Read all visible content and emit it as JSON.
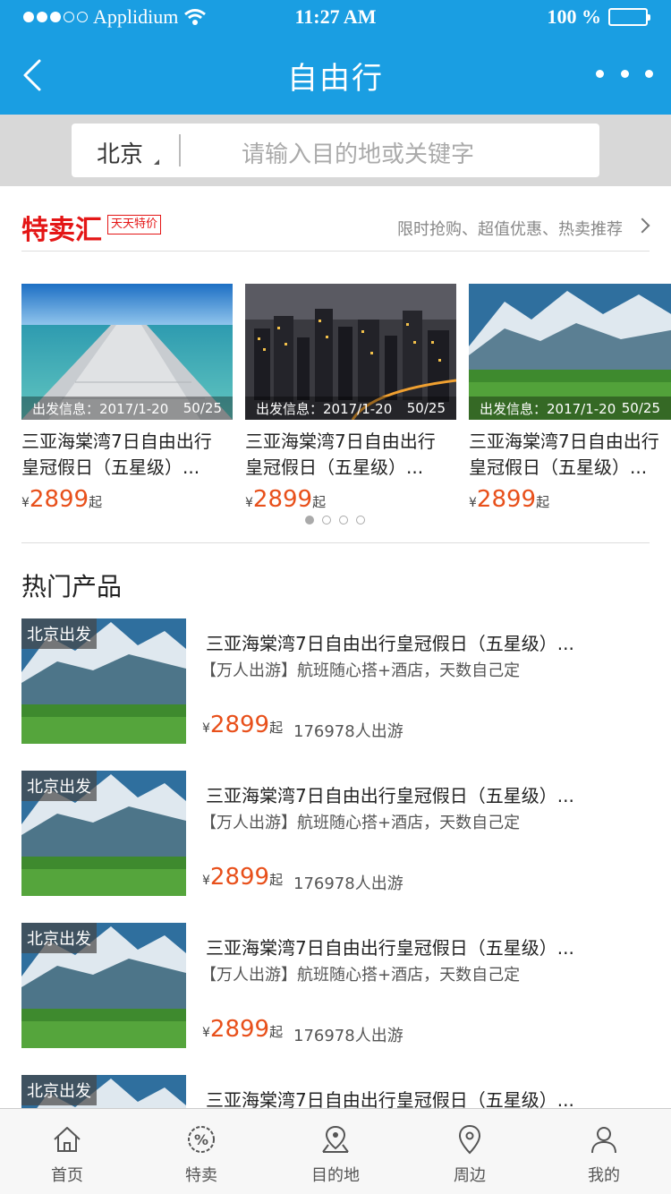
{
  "status_bar": {
    "carrier": "Applidium",
    "time": "11:27 AM",
    "battery": "100 %"
  },
  "nav": {
    "title": "自由行"
  },
  "search": {
    "city": "北京",
    "placeholder": "请输入目的地或关键字"
  },
  "sale": {
    "title": "特卖汇",
    "badge": "天天特价",
    "subtitle": "限时抢购、超值优惠、热卖推荐",
    "cards": [
      {
        "info_label": "出发信息：2017/1-20",
        "info_count": "50/25",
        "title_line1": "三亚海棠湾7日自由出行",
        "title_line2": "皇冠假日（五星级）...",
        "currency": "¥",
        "price": "2899",
        "suffix": "起"
      },
      {
        "info_label": "出发信息：2017/1-20",
        "info_count": "50/25",
        "title_line1": "三亚海棠湾7日自由出行",
        "title_line2": "皇冠假日（五星级）...",
        "currency": "¥",
        "price": "2899",
        "suffix": "起"
      },
      {
        "info_label": "出发信息：2017/1-20",
        "info_count": "50/25",
        "title_line1": "三亚海棠湾7日自由出行",
        "title_line2": "皇冠假日（五星级）...",
        "currency": "¥",
        "price": "2899",
        "suffix": "起"
      }
    ],
    "pager_total": 4,
    "pager_active": 0
  },
  "hot": {
    "title": "热门产品",
    "items": [
      {
        "tag": "北京出发",
        "title": "三亚海棠湾7日自由出行皇冠假日（五星级）...",
        "desc": "【万人出游】航班随心搭+酒店，天数自己定",
        "currency": "¥",
        "price": "2899",
        "suffix": "起",
        "count": "176978人出游"
      },
      {
        "tag": "北京出发",
        "title": "三亚海棠湾7日自由出行皇冠假日（五星级）...",
        "desc": "【万人出游】航班随心搭+酒店，天数自己定",
        "currency": "¥",
        "price": "2899",
        "suffix": "起",
        "count": "176978人出游"
      },
      {
        "tag": "北京出发",
        "title": "三亚海棠湾7日自由出行皇冠假日（五星级）...",
        "desc": "【万人出游】航班随心搭+酒店，天数自己定",
        "currency": "¥",
        "price": "2899",
        "suffix": "起",
        "count": "176978人出游"
      },
      {
        "tag": "北京出发",
        "title": "三亚海棠湾7日自由出行皇冠假日（五星级）..."
      }
    ]
  },
  "tabbar": {
    "tabs": [
      {
        "label": "首页",
        "icon": "home-icon"
      },
      {
        "label": "特卖",
        "icon": "discount-icon"
      },
      {
        "label": "目的地",
        "icon": "map-pin-icon"
      },
      {
        "label": "周边",
        "icon": "location-icon"
      },
      {
        "label": "我的",
        "icon": "user-icon"
      }
    ]
  },
  "colors": {
    "header": "#1a9ee2",
    "accent_red": "#e41616",
    "price": "#e8501b"
  }
}
